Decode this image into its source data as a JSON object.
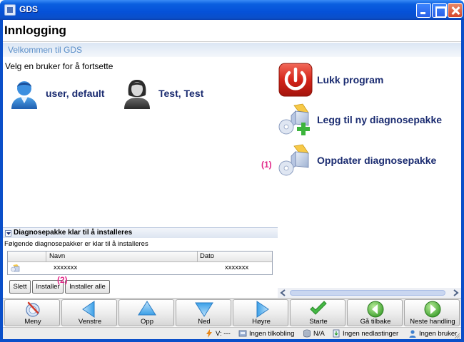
{
  "window": {
    "title": "GDS"
  },
  "page": {
    "title": "Innlogging",
    "welcome": "Velkommen til GDS",
    "prompt": "Velg en bruker for å fortsette"
  },
  "users": [
    {
      "name": "user, default",
      "icon": "male-user-icon"
    },
    {
      "name": "Test, Test",
      "icon": "female-user-icon"
    }
  ],
  "actions": [
    {
      "label": "Lukk program",
      "icon": "power-icon"
    },
    {
      "label": "Legg til ny diagnosepakke",
      "icon": "add-package-icon"
    },
    {
      "label": "Oppdater diagnosepakke",
      "icon": "update-package-icon"
    }
  ],
  "markers": {
    "one": "(1)",
    "two": "(2)"
  },
  "packages": {
    "header": "Diagnosepakke klar til å installeres",
    "subtitle": "Følgende diagnosepakker er klar til å installeres",
    "columns": {
      "name": "Navn",
      "date": "Dato"
    },
    "rows": [
      {
        "name": "xxxxxxx",
        "date": "xxxxxxx"
      }
    ],
    "buttons": {
      "delete": "Slett",
      "install": "Installer",
      "install_all": "Installer alle"
    }
  },
  "toolbar": [
    {
      "label": "Meny",
      "icon": "menu-icon"
    },
    {
      "label": "Venstre",
      "icon": "arrow-left-icon"
    },
    {
      "label": "Opp",
      "icon": "arrow-up-icon"
    },
    {
      "label": "Ned",
      "icon": "arrow-down-icon"
    },
    {
      "label": "Høyre",
      "icon": "arrow-right-icon"
    },
    {
      "label": "Starte",
      "icon": "checkmark-icon"
    },
    {
      "label": "Gå tilbake",
      "icon": "back-icon"
    },
    {
      "label": "Neste handling",
      "icon": "next-icon"
    }
  ],
  "status": {
    "voltage": "V: ---",
    "connection": "Ingen tilkobling",
    "storage": "N/A",
    "downloads": "Ingen nedlastinger",
    "user": "Ingen bruker"
  },
  "colors": {
    "accent": "#1a2b70",
    "marker": "#e2298a",
    "title_bar": "#0a5fe0"
  }
}
